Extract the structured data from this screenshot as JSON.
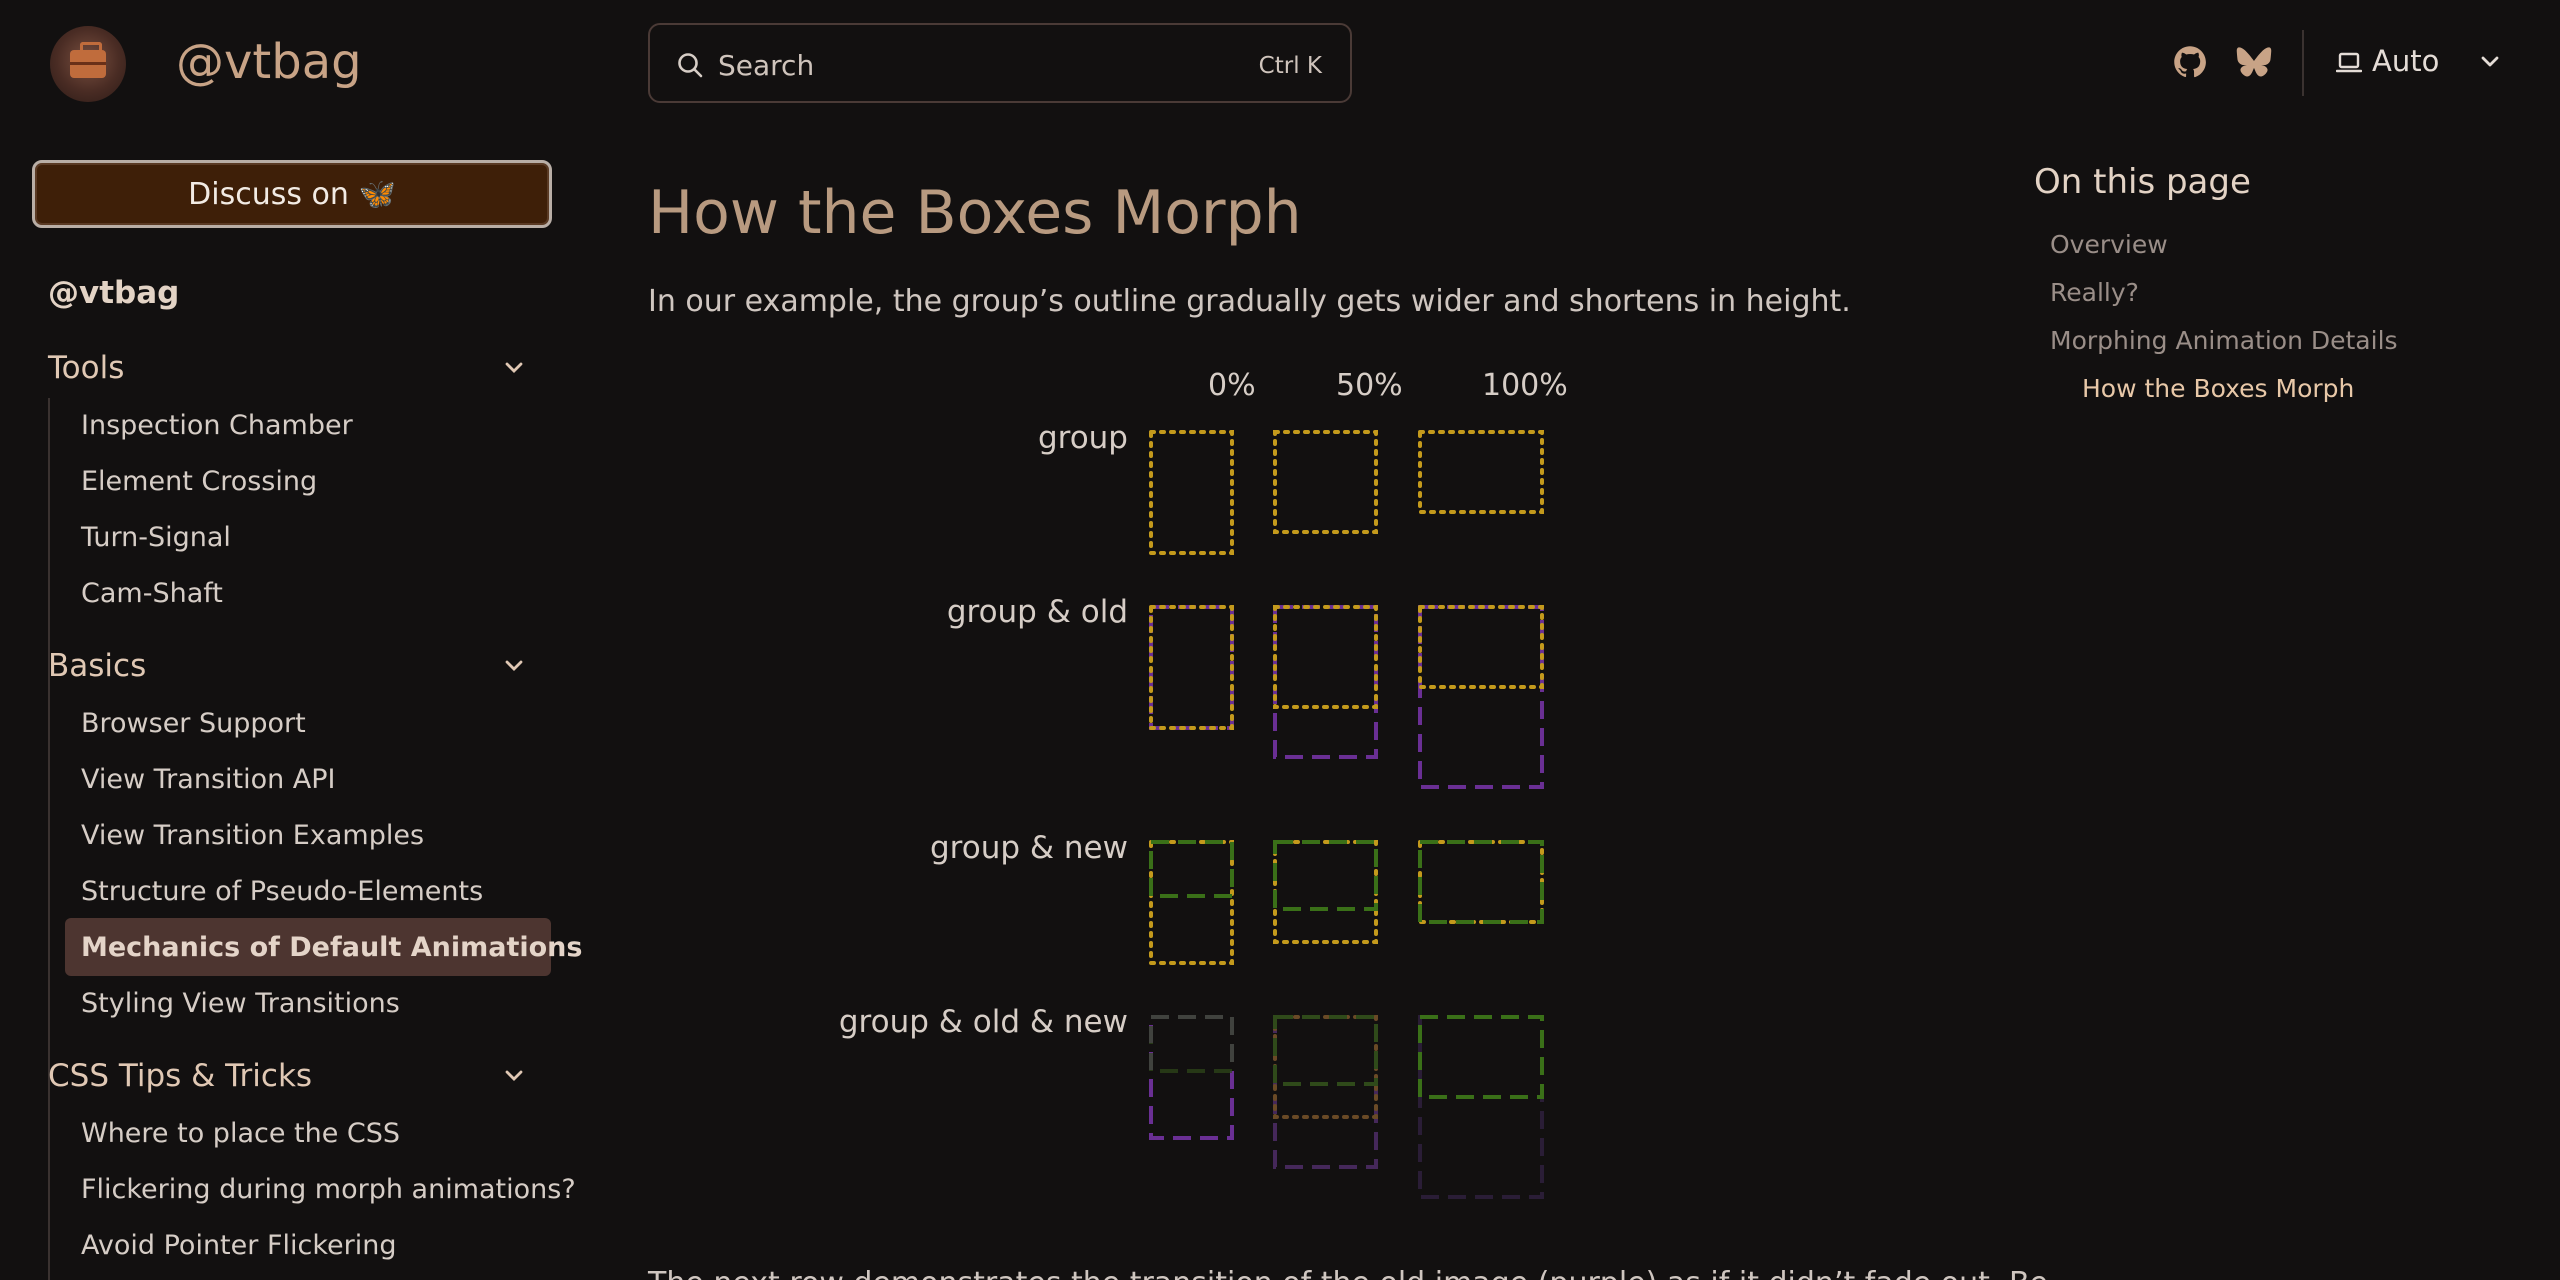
{
  "header": {
    "site_title": "@vtbag",
    "search": {
      "placeholder": "Search",
      "shortcut": "Ctrl K"
    },
    "theme": {
      "label": "Auto"
    },
    "icons": [
      "logo-briefcase",
      "search-icon",
      "github-icon",
      "bluesky-icon",
      "laptop-icon",
      "chevron-down-icon"
    ]
  },
  "sidebar": {
    "discuss_label": "Discuss on 🦋",
    "root_label": "@vtbag",
    "groups": [
      {
        "label": "Tools",
        "items": [
          "Inspection Chamber",
          "Element Crossing",
          "Turn-Signal",
          "Cam-Shaft"
        ]
      },
      {
        "label": "Basics",
        "items": [
          "Browser Support",
          "View Transition API",
          "View Transition Examples",
          "Structure of Pseudo-Elements",
          "Mechanics of Default Animations",
          "Styling View Transitions"
        ]
      },
      {
        "label": "CSS Tips & Tricks",
        "items": [
          "Where to place the CSS",
          "Flickering during morph animations?",
          "Avoid Pointer Flickering"
        ]
      }
    ],
    "active_item": "Mechanics of Default Animations"
  },
  "main": {
    "title": "How the Boxes Morph",
    "intro": "In our example, the group’s outline gradually gets wider and shortens in height.",
    "percent_labels": [
      "0%",
      "50%",
      "100%"
    ],
    "row_labels": [
      "group",
      "group & old",
      "group & new",
      "group & old & new"
    ],
    "bottom_text": "The next row demonstrates the transition of the old image (purple) as if it didn’t fade out. Be"
  },
  "toc": {
    "title": "On this page",
    "items": [
      "Overview",
      "Really?",
      "Morphing Animation Details",
      "How the Boxes Morph"
    ],
    "active_item": "How the Boxes Morph"
  },
  "colors": {
    "group": "#c49a1c",
    "old": "#6a2f94",
    "new": "#3a7018",
    "accent": "#c8a386",
    "active_bg": "#4d3530"
  }
}
